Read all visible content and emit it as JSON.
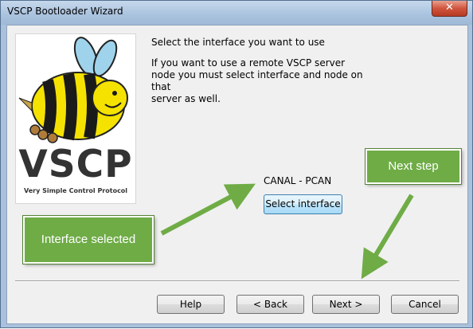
{
  "window": {
    "title": "VSCP  Bootloader Wizard",
    "close_glyph": "✕"
  },
  "logo": {
    "title": "VSCP",
    "subtitle": "Very Simple Control Protocol"
  },
  "content": {
    "heading": "Select the interface you want to use",
    "info_line1": "If you want to use a remote VSCP server",
    "info_line2": "node you must  select interface and node on that",
    "info_line3": "server as well.",
    "interface_name": "CANAL - PCAN",
    "select_button": "Select interface"
  },
  "buttons": {
    "help": "Help",
    "back": "< Back",
    "next": "Next >",
    "cancel": "Cancel"
  },
  "annotations": {
    "interface_selected": "Interface selected",
    "next_step": "Next step"
  },
  "colors": {
    "callout_fill": "#6fac46",
    "arrow": "#6fac46",
    "bee_yellow": "#f5e200",
    "bee_black": "#1a1a1a",
    "wing_blue": "#9fd3ec"
  }
}
